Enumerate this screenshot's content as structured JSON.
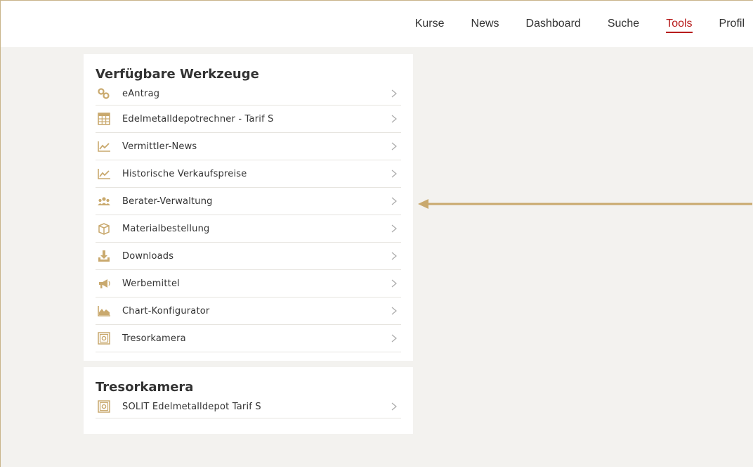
{
  "nav": {
    "items": [
      {
        "label": "Kurse"
      },
      {
        "label": "News"
      },
      {
        "label": "Dashboard"
      },
      {
        "label": "Suche"
      },
      {
        "label": "Tools",
        "active": true
      },
      {
        "label": "Profil"
      }
    ]
  },
  "tools_card": {
    "title": "Verfügbare Werkzeuge",
    "items": [
      {
        "label": "eAntrag",
        "icon": "link-icon"
      },
      {
        "label": "Edelmetalldepotrechner - Tarif S",
        "icon": "calculator-icon"
      },
      {
        "label": "Vermittler-News",
        "icon": "line-chart-icon"
      },
      {
        "label": "Historische Verkaufspreise",
        "icon": "line-chart-icon"
      },
      {
        "label": "Berater-Verwaltung",
        "icon": "users-icon"
      },
      {
        "label": "Materialbestellung",
        "icon": "box-icon"
      },
      {
        "label": "Downloads",
        "icon": "download-icon"
      },
      {
        "label": "Werbemittel",
        "icon": "megaphone-icon"
      },
      {
        "label": "Chart-Konfigurator",
        "icon": "area-chart-icon"
      },
      {
        "label": "Tresorkamera",
        "icon": "safe-icon"
      }
    ]
  },
  "camera_card": {
    "title": "Tresorkamera",
    "items": [
      {
        "label": "SOLIT Edelmetalldepot Tarif S",
        "icon": "safe-icon"
      }
    ]
  },
  "colors": {
    "accent": "#c9a96e",
    "active_nav": "#b71c1c",
    "background": "#f3f2ef"
  }
}
